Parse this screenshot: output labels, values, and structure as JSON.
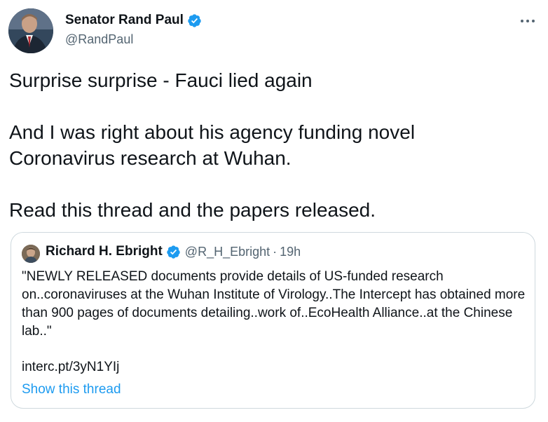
{
  "author": {
    "name": "Senator Rand Paul",
    "handle": "@RandPaul",
    "verified_icon": "verified-badge-icon"
  },
  "tweet": {
    "lines": [
      "Surprise surprise - Fauci lied again",
      "And I was right about his agency funding novel Coronavirus research at Wuhan.",
      "Read this thread and the papers released."
    ]
  },
  "quoted": {
    "name": "Richard H. Ebright",
    "handle": "@R_H_Ebright",
    "separator": "·",
    "time": "19h",
    "text": "\"NEWLY RELEASED documents provide details of US-funded research on..coronaviruses at the Wuhan Institute of Virology..The Intercept has obtained more than 900 pages of documents detailing..work of..EcoHealth Alliance..at the Chinese lab..\"",
    "link": "interc.pt/3yN1YIj",
    "show_thread": "Show this thread"
  },
  "colors": {
    "accent": "#1d9bf0",
    "secondary_text": "#536471",
    "border": "#cfd9de"
  }
}
